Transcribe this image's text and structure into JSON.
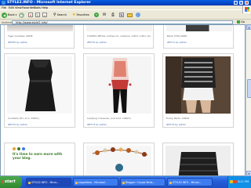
{
  "window": {
    "title": "STYLE2.INFO - Microsoft Internet Explorer"
  },
  "menu": [
    "File",
    "Edit",
    "View",
    "Favorites",
    "Tools",
    "Help"
  ],
  "toolbar": {
    "back_label": "Back",
    "search_label": "Search",
    "favorites_label": "Favorites"
  },
  "address": {
    "label": "Address",
    "url": "http://www.style2.info/",
    "go_label": "Go"
  },
  "cards": {
    "top": [
      {
        "caption": "Tiger Goddess: 99HR",
        "meta": "#8765 by admin"
      },
      {
        "caption": "TUXEDO METAL clothes t-b, material: 100% cotton (S)",
        "meta": "#8770 by admin"
      },
      {
        "caption": "Black (FW)-99HR",
        "meta": "#8771 by admin"
      }
    ],
    "middle": [
      {
        "caption": "Cocktails (M L-G-S, 29821)",
        "meta": "#8772 by admin"
      },
      {
        "caption": "Ladybug 3 sleeves, (not sold, 19823)",
        "meta": "#8773 by admin"
      },
      {
        "caption": "Funky Pants, 29816",
        "meta": "#8774 by admin"
      }
    ]
  },
  "promo": {
    "text": "It's time to earn more with your blog."
  },
  "taskbar": {
    "start": "start",
    "tasks": [
      "STYLE2.INFO - Micro...",
      "zappelbow - Microsof...",
      "Blogger: Couple Birds...",
      "STYLE2.INFO - Micros..."
    ],
    "time": "8:11 PM"
  }
}
